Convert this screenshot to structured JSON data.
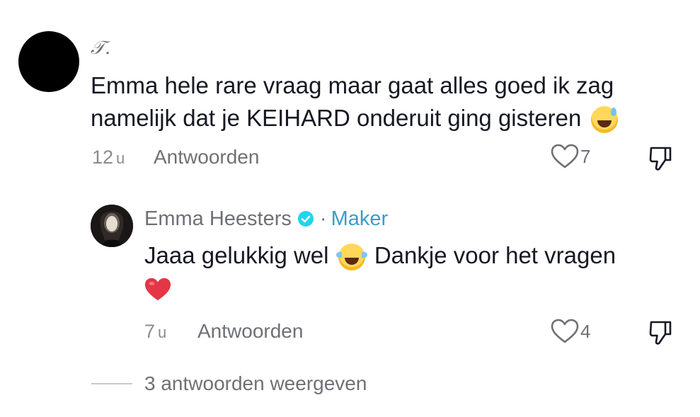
{
  "comment": {
    "username": "𝒯.",
    "text": "Emma hele rare vraag maar gaat alles goed ik zag namelijk dat je KEIHARD onderuit ging gisteren",
    "emoji": "sweat-smile-emoji",
    "time_value": "12",
    "time_unit": "u",
    "reply_label": "Antwoorden",
    "likes": "7",
    "like_icon": "heart-outline-icon",
    "dislike_icon": "thumbs-down-icon"
  },
  "reply": {
    "author": "Emma Heesters",
    "verified_icon": "verified-badge-icon",
    "separator": "·",
    "badge": "Maker",
    "text_part1": "Jaaa gelukkig wel",
    "emoji1": "tears-of-joy-emoji",
    "text_part2": "Dankje voor het vragen",
    "emoji2": "red-heart-emoji",
    "time_value": "7",
    "time_unit": "u",
    "reply_label": "Antwoorden",
    "likes": "4",
    "like_icon": "heart-outline-icon",
    "dislike_icon": "thumbs-down-icon"
  },
  "more_replies": {
    "label": "3 antwoorden weergeven"
  },
  "colors": {
    "text_primary": "#161823",
    "text_secondary": "#6f7075",
    "maker_accent": "#3a9dc6",
    "verified_blue": "#20d5ec"
  }
}
